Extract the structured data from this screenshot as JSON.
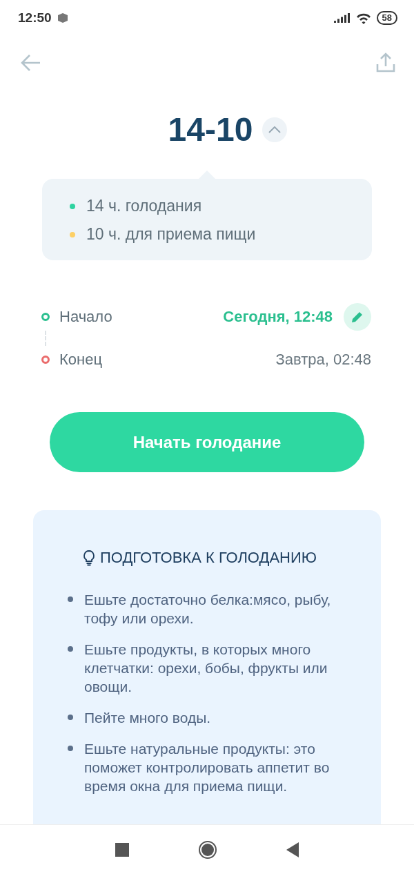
{
  "status_bar": {
    "time": "12:50",
    "battery": "58"
  },
  "plan": {
    "title": "14-10",
    "expanded": true
  },
  "phases": [
    {
      "label": "14 ч. голодания",
      "color": "#2ed3a0"
    },
    {
      "label": "10 ч. для приема пищи",
      "color": "#fdd066"
    }
  ],
  "schedule": [
    {
      "label": "Начало",
      "value": "Сегодня, 12:48",
      "color": "#2bbf8f",
      "editable": true
    },
    {
      "label": "Конец",
      "value": "Завтра, 02:48",
      "color": "#ea6b6b",
      "editable": false
    }
  ],
  "start_button": "Начать голодание",
  "tips": {
    "title": "ПОДГОТОВКА К ГОЛОДАНИЮ",
    "items": [
      "Ешьте достаточно белка:мясо, рыбу, тофу или орехи.",
      "Ешьте продукты, в которых много клетчатки: орехи, бобы, фрукты или овощи.",
      "Пейте много воды.",
      "Ешьте натуральные продукты: это поможет контролировать аппетит во время окна для приема пищи."
    ]
  }
}
